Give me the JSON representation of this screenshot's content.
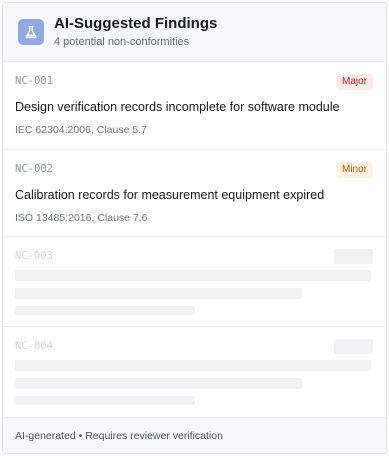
{
  "header": {
    "title": "AI-Suggested Findings",
    "subtitle": "4 potential non-conformities",
    "icon": "flask-icon"
  },
  "findings": [
    {
      "id": "NC-001",
      "severity": "Major",
      "title": "Design verification records incomplete for software module",
      "reference": "IEC 62304:2006, Clause 5.7"
    },
    {
      "id": "NC-002",
      "severity": "Minor",
      "title": "Calibration records for measurement equipment expired",
      "reference": "ISO 13485:2016, Clause 7.6"
    },
    {
      "id": "NC-003",
      "loading": true
    },
    {
      "id": "NC-004",
      "loading": true
    }
  ],
  "footer": {
    "note": "AI-generated • Requires reviewer verification"
  },
  "colors": {
    "major_text": "#c0202a",
    "major_bg": "#fdecec",
    "minor_text": "#b05d06",
    "minor_bg": "#fff4df",
    "icon_bg": "#8fa9e6"
  }
}
